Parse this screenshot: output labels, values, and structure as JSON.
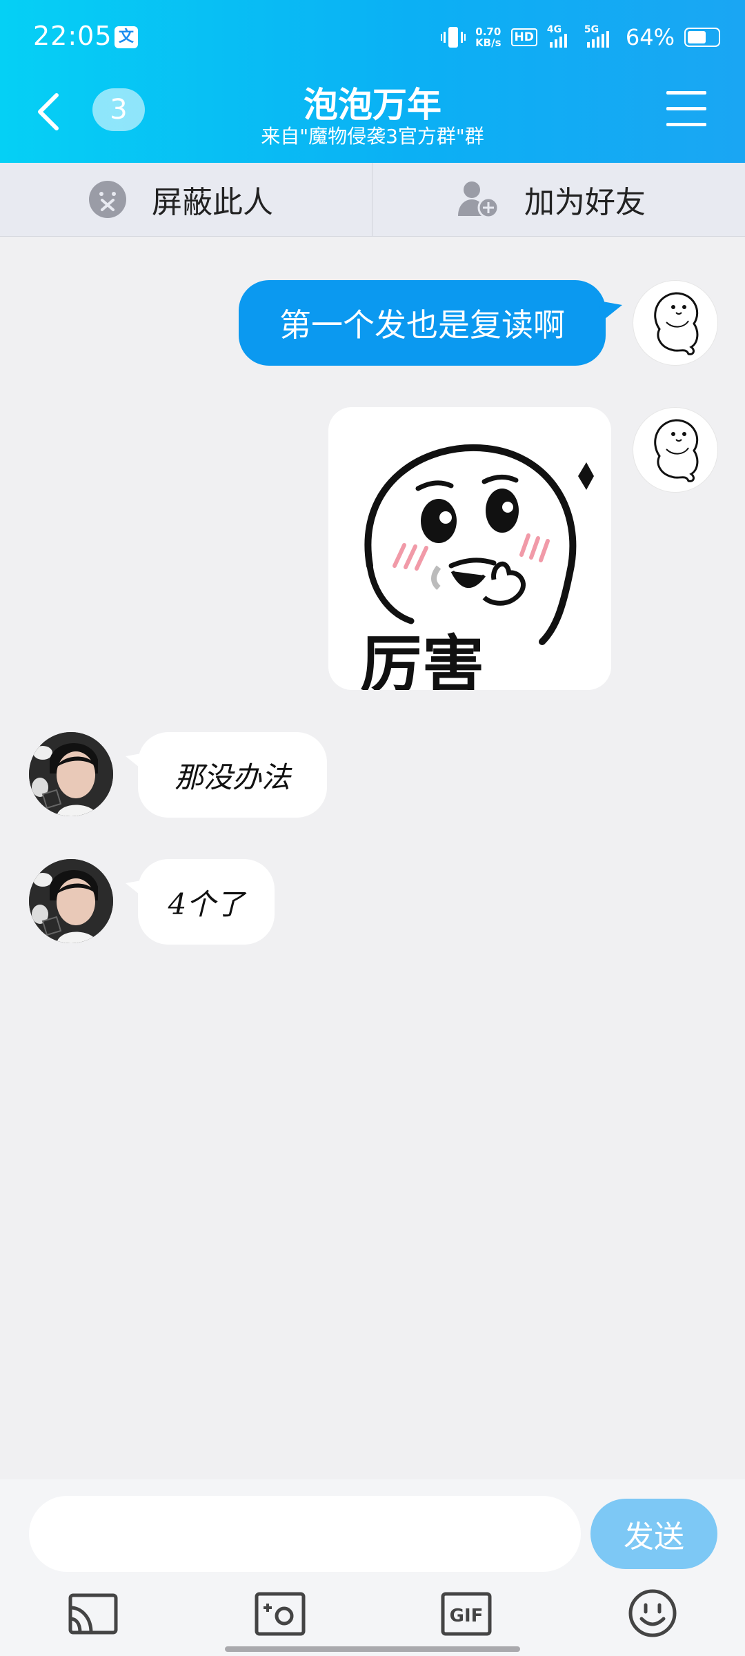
{
  "status_bar": {
    "time": "22:05",
    "translate_badge": "文",
    "net_speed_value": "0.70",
    "net_speed_unit": "KB/s",
    "hd_label": "HD",
    "signal_1": "4G",
    "signal_2": "5G",
    "battery_percent": "64%",
    "battery_level": 0.64
  },
  "header": {
    "back_icon": "chevron-left-icon",
    "unread_count": "3",
    "title": "泡泡万年",
    "subtitle": "来自\"魔物侵袭3官方群\"群",
    "menu_icon": "hamburger-menu-icon"
  },
  "actions": {
    "block_label": "屏蔽此人",
    "block_icon": "block-user-icon",
    "add_friend_label": "加为好友",
    "add_friend_icon": "add-friend-icon"
  },
  "messages": [
    {
      "sender": "self",
      "type": "text",
      "text": "第一个发也是复读啊"
    },
    {
      "sender": "self",
      "type": "sticker",
      "caption": "厉害"
    },
    {
      "sender": "other",
      "type": "text",
      "text": "那没办法"
    },
    {
      "sender": "other",
      "type": "text",
      "text": "4个了"
    }
  ],
  "input": {
    "value": "",
    "placeholder": "",
    "send_label": "发送"
  },
  "toolbar": {
    "icons": [
      "screen-cast-icon",
      "photo-camera-icon",
      "gif-icon",
      "emoji-icon"
    ],
    "gif_label": "GIF"
  },
  "colors": {
    "header_start": "#05d0f5",
    "header_end": "#1aa6f3",
    "outgoing_bubble": "#0b99f0",
    "send_button": "#7dc8f5",
    "background": "#f0f0f2"
  }
}
